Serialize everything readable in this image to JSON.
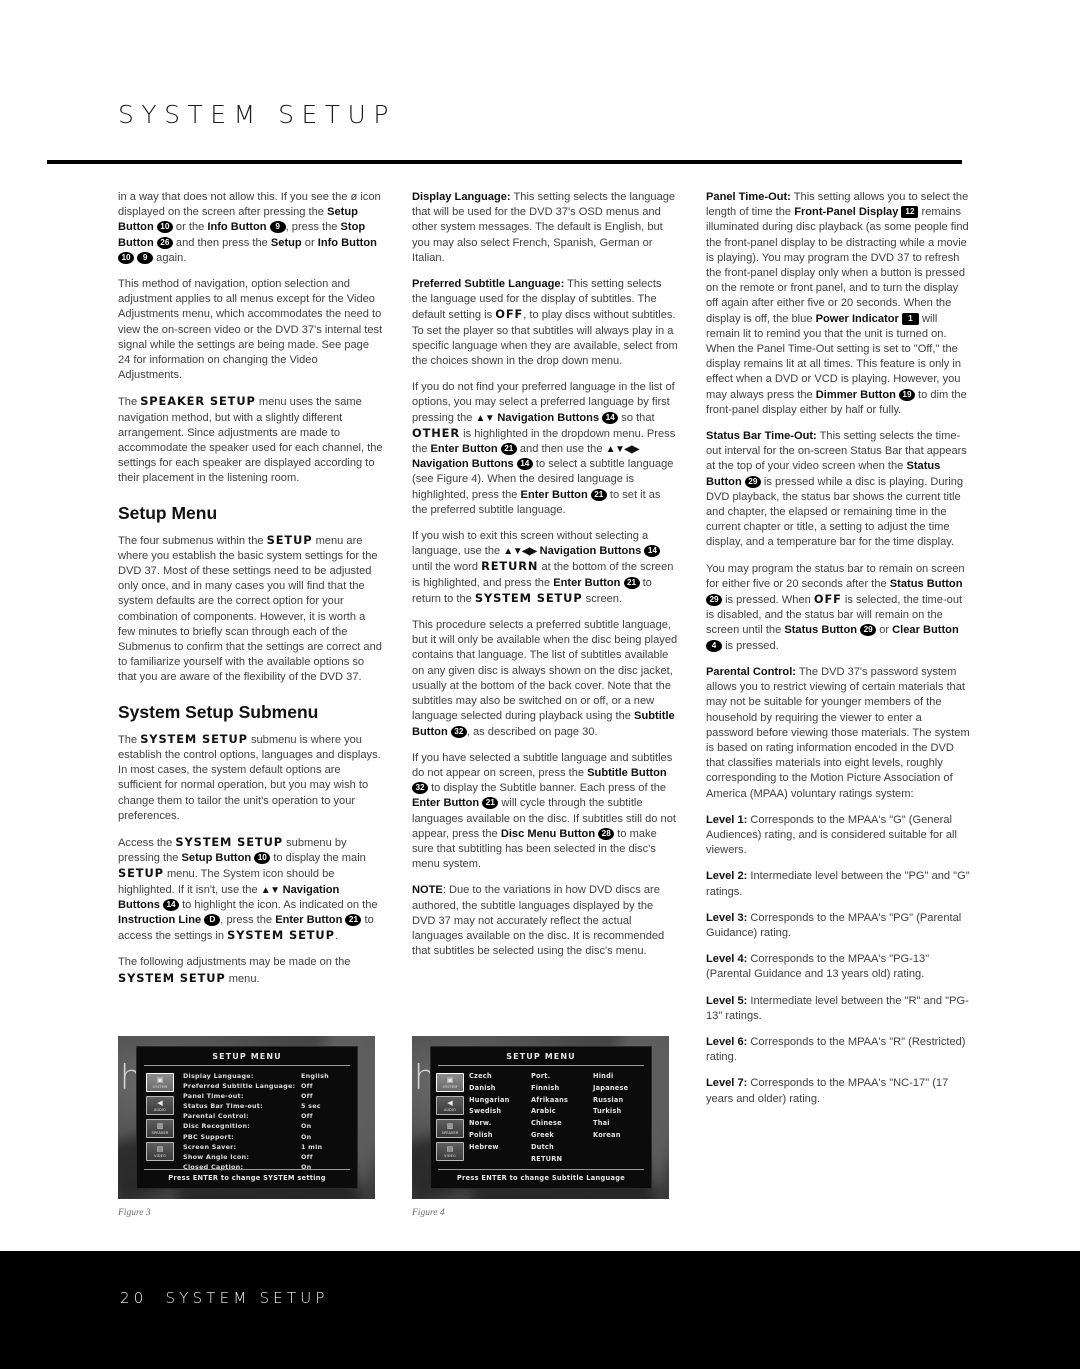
{
  "page": {
    "title": "SYSTEM SETUP",
    "footer_page_number": "20",
    "footer_title": "SYSTEM SETUP"
  },
  "column1": {
    "p1": {
      "pre": "in a way that does not allow this. If you see the ø icon displayed on the screen after pressing the ",
      "b1": "Setup Button",
      "badge1": "10",
      "mid1": " or the ",
      "b2": "Info Button",
      "badge2": "9",
      "mid2": ", press the ",
      "b3": "Stop Button",
      "badge3": "26",
      "mid3": " and then press the ",
      "b4": "Setup",
      "mid4": " or ",
      "b5": "Info Button",
      "badge4": "10",
      "badge5": "9",
      "post": " again."
    },
    "p2": "This method of navigation, option selection and adjustment applies to all menus except for the Video Adjustments menu, which accommodates the need to view the on-screen video or the DVD 37's internal test signal while the settings are being made. See page 24 for information on changing the Video Adjustments.",
    "p3": {
      "pre": "The ",
      "sc": "SPEAKER SETUP",
      "post": " menu uses the same navigation method, but with a slightly different arrangement. Since adjustments are made to accommodate the speaker used for each channel, the settings for each speaker are displayed according to their placement in the listening room."
    },
    "heading_setup_menu": "Setup Menu",
    "p4": {
      "pre": "The four submenus within the ",
      "sc": "SETUP",
      "post": " menu are where you establish the basic system settings for the DVD 37. Most of these settings need to be adjusted only once, and in many cases you will find that the system defaults are the correct option for your combination of components. However, it is worth a few minutes to briefly scan through each of the Submenus to confirm that the settings are correct and to familiarize yourself with the available options so that you are aware of the flexibility of the DVD 37."
    },
    "heading_system_setup_submenu": "System Setup Submenu",
    "p5": {
      "pre": "The ",
      "sc": "SYSTEM SETUP",
      "post": " submenu is where you establish the control options, languages and displays. In most cases, the system default options are sufficient for normal operation, but you may wish to change them to tailor the unit's operation to your preferences."
    },
    "p6": {
      "t1": "Access the ",
      "sc1": "SYSTEM SETUP",
      "t2": " submenu by pressing the ",
      "b1": "Setup Button",
      "badge1": "10",
      "t3": " to display the main ",
      "sc2": "SETUP",
      "t4": " menu. The System icon should be highlighted. If it isn't, use the ",
      "arrows1": "▲▼",
      "b2": "Navigation Buttons",
      "badge2": "14",
      "t5": " to highlight the icon. As indicated on the ",
      "b3": "Instruction Line",
      "badge3": "D",
      "t6": ", press the ",
      "b4": "Enter Button",
      "badge4": "21",
      "t7": " to access the settings in ",
      "sc3": "SYSTEM SETUP",
      "t8": "."
    },
    "p7": {
      "pre": "The following adjustments may be made on the ",
      "sc": "SYSTEM SETUP",
      "post": " menu."
    }
  },
  "column2": {
    "p1": {
      "b": "Display Language:",
      "t": " This setting selects the language that will be used for the DVD 37's OSD menus and other system messages. The default is English, but you may also select French, Spanish, German or Italian."
    },
    "p2": {
      "b": "Preferred Subtitle Language:",
      "t1": " This setting selects the language used for the display of subtitles. The default setting is ",
      "sc": "OFF",
      "t2": ", to play discs without subtitles. To set the player so that subtitles will always play in a specific language when they are available, select from the choices shown in the drop down menu."
    },
    "p3": {
      "t1": "If you do not find your preferred language in the list of options, you may select a preferred language by first pressing the ",
      "arrows1": "▲▼",
      "b1": "Navigation Buttons",
      "badge1": "14",
      "t2": " so that ",
      "sc1": "OTHER",
      "t3": " is highlighted in the dropdown menu. Press the ",
      "b2": "Enter Button",
      "badge2": "21",
      "t4": " and then use the ",
      "arrows2": "▲▼◀▶",
      "b3": "Navigation Buttons",
      "badge3": "14",
      "t5": " to select a subtitle language (see Figure 4). When the desired language is highlighted, press the ",
      "b4": "Enter Button",
      "badge4": "21",
      "t6": " to set it as the preferred subtitle language."
    },
    "p4": {
      "t1": "If you wish to exit this screen without selecting a language, use the ",
      "arrows1": "▲▼◀▶",
      "b1": "Navigation Buttons",
      "badge1": "14",
      "t2": " until the word ",
      "sc1": "RETURN",
      "t3": " at the bottom of the screen is highlighted, and press the ",
      "b2": "Enter Button",
      "badge2": "21",
      "t4": " to return to the ",
      "sc2": "SYSTEM SETUP",
      "t5": " screen."
    },
    "p5": {
      "t1": "This procedure selects a preferred subtitle language, but it will only be available when the disc being played contains that language. The list of subtitles available on any given disc is always shown on the disc jacket, usually at the bottom of the back cover. Note that the subtitles may also be switched on or off, or a new language selected during playback using the ",
      "b1": "Subtitle Button",
      "badge1": "32",
      "t2": ", as described on page 30."
    },
    "p6": {
      "t1": "If you have selected a subtitle language and subtitles do not appear on screen, press the ",
      "b1": "Subtitle Button",
      "badge1": "32",
      "t2": " to display the Subtitle banner. Each press of the ",
      "b2": "Enter Button",
      "badge2": "21",
      "t3": " will cycle through the subtitle languages available on the disc. If subtitles still do not appear, press the ",
      "b3": "Disc Menu Button",
      "badge3": "28",
      "t4": " to make sure that subtitling has been selected in the disc's menu system."
    },
    "p7": {
      "b": "NOTE",
      "t": ": Due to the variations in how DVD discs are authored, the subtitle languages displayed by the DVD 37 may not accurately reflect the actual languages available on the disc. It is recommended that subtitles be selected using the disc's menu."
    }
  },
  "column3": {
    "p1": {
      "b": "Panel Time-Out:",
      "t1": " This setting allows you to select the length of time the ",
      "b1": "Front-Panel Display",
      "badge1": "12",
      "t2": " remains illuminated during disc playback (as some people find the front-panel display to be distracting while a movie is playing). You may program the DVD 37 to refresh the front-panel display only when a button is pressed on the remote or front panel, and to turn the display off again after either five or 20 seconds. When the display is off, the blue ",
      "b2": "Power Indicator",
      "badge2": "1",
      "t3": " will remain lit to remind you that the unit is turned on. When the Panel Time-Out setting is set to \"Off,\" the display remains lit at all times. This feature is only in effect when a DVD or VCD is playing. However, you may always press the ",
      "b3": "Dimmer Button",
      "badge3": "19",
      "t4": " to dim the front-panel display either by half or fully."
    },
    "p2": {
      "b": "Status Bar Time-Out:",
      "t1": " This setting selects the time-out interval for the on-screen Status Bar that appears at the top of your video screen when the ",
      "b1": "Status Button",
      "badge1": "29",
      "t2": " is pressed while a disc is playing. During DVD playback, the status bar shows the current title and chapter, the elapsed or remaining time in the current chapter or title, a setting to adjust the time display, and a temperature bar for the time display."
    },
    "p3": {
      "t1": "You may program the status bar to remain on screen for either five or 20 seconds after the ",
      "b1": "Status Button",
      "badge1": "29",
      "t2": " is pressed. When ",
      "sc1": "OFF",
      "t3": " is selected, the time-out is disabled, and the status bar will remain on the screen until the ",
      "b2": "Status Button",
      "badge2": "29",
      "t4": " or ",
      "b3": "Clear Button",
      "badge3": "4",
      "t5": " is pressed."
    },
    "p4": {
      "b": "Parental Control:",
      "t": " The DVD 37's password system allows you to restrict viewing of certain materials that may not be suitable for younger members of the household by requiring the viewer to enter a password before viewing those materials. The system is based on rating information encoded in the DVD that classifies materials into eight levels, roughly corresponding to the Motion Picture Association of America (MPAA) voluntary ratings system:"
    },
    "levels": [
      {
        "label": "Level 1:",
        "text": " Corresponds to the MPAA's \"G\" (General Audiences) rating, and is considered suitable for all viewers."
      },
      {
        "label": "Level 2:",
        "text": " Intermediate level between the \"PG\" and \"G\" ratings."
      },
      {
        "label": "Level 3:",
        "text": " Corresponds to the MPAA's \"PG\" (Parental Guidance) rating."
      },
      {
        "label": "Level 4:",
        "text": " Corresponds to the MPAA's \"PG-13\" (Parental Guidance and 13 years old) rating."
      },
      {
        "label": "Level 5:",
        "text": " Intermediate level between the \"R\" and \"PG-13\" ratings."
      },
      {
        "label": "Level 6:",
        "text": " Corresponds to the MPAA's \"R\" (Restricted) rating."
      },
      {
        "label": "Level 7:",
        "text": " Corresponds to the MPAA's \"NC-17\" (17 years and older) rating."
      }
    ]
  },
  "figure3": {
    "caption": "Figure 3",
    "osd_title": "SETUP MENU",
    "footer": "Press ENTER to change SYSTEM setting",
    "icons": [
      {
        "glyph": "▣",
        "caption": "SYSTEM",
        "selected": true
      },
      {
        "glyph": "◀",
        "caption": "AUDIO",
        "selected": false
      },
      {
        "glyph": "▥",
        "caption": "SPEAKER",
        "selected": false
      },
      {
        "glyph": "▤",
        "caption": "VIDEO",
        "selected": false
      }
    ],
    "rows": [
      {
        "label": "Display Language:",
        "value": "English"
      },
      {
        "label": "Preferred Subtitle Language:",
        "value": "Off"
      },
      {
        "label": "Panel Time-out:",
        "value": "Off"
      },
      {
        "label": "Status Bar Time-out:",
        "value": "5 sec"
      },
      {
        "label": "Parental Control:",
        "value": "Off"
      },
      {
        "label": "Disc Recognition:",
        "value": "On"
      },
      {
        "label": "PBC Support:",
        "value": "On"
      },
      {
        "label": "Screen Saver:",
        "value": "1 min"
      },
      {
        "label": "Show Angle Icon:",
        "value": "Off"
      },
      {
        "label": "Closed Caption:",
        "value": "On"
      }
    ]
  },
  "figure4": {
    "caption": "Figure 4",
    "osd_title": "SETUP MENU",
    "footer": "Press ENTER to change Subtitle Language",
    "icons": [
      {
        "glyph": "▣",
        "caption": "SYSTEM",
        "selected": true
      },
      {
        "glyph": "◀",
        "caption": "AUDIO",
        "selected": false
      },
      {
        "glyph": "▥",
        "caption": "SPEAKER",
        "selected": false
      },
      {
        "glyph": "▤",
        "caption": "VIDEO",
        "selected": false
      }
    ],
    "lang_col1": [
      "Czech",
      "Danish",
      "Hungarian",
      "Swedish",
      "Norw.",
      "Polish",
      "Hebrew"
    ],
    "lang_col2": [
      "Port.",
      "Finnish",
      "Afrikaans",
      "Arabic",
      "Chinese",
      "Greek",
      "Dutch",
      "RETURN"
    ],
    "lang_col3": [
      "Hindi",
      "Japanese",
      "Russian",
      "Turkish",
      "Thai",
      "Korean"
    ],
    "highlighted": "Czech"
  }
}
